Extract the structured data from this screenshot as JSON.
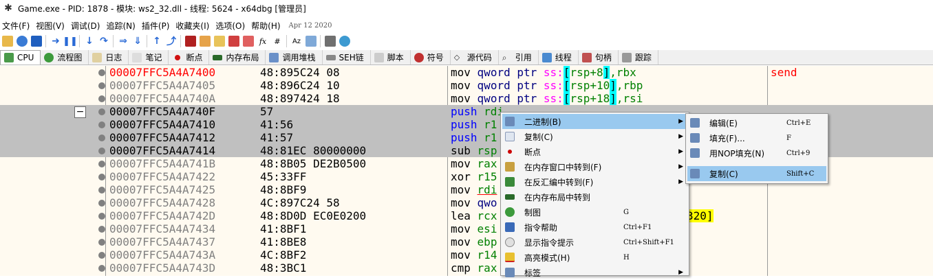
{
  "titlebar": {
    "title": "Game.exe - PID: 1878 - 模块: ws2_32.dll - 线程: 5624 - x64dbg [管理员]"
  },
  "menu": {
    "items": [
      "文件(F)",
      "视图(V)",
      "调试(D)",
      "追踪(N)",
      "插件(P)",
      "收藏夹(I)",
      "选项(O)",
      "帮助(H)"
    ],
    "date": "Apr 12 2020"
  },
  "tabs": [
    {
      "label": "CPU",
      "icon": "cpu-icon"
    },
    {
      "label": "流程图",
      "icon": "tree-icon"
    },
    {
      "label": "日志",
      "icon": "log-icon"
    },
    {
      "label": "笔记",
      "icon": "notes-icon"
    },
    {
      "label": "断点",
      "icon": "breakpoint-icon"
    },
    {
      "label": "内存布局",
      "icon": "memory-icon"
    },
    {
      "label": "调用堆栈",
      "icon": "callstack-icon"
    },
    {
      "label": "SEH链",
      "icon": "seh-icon"
    },
    {
      "label": "脚本",
      "icon": "script-icon"
    },
    {
      "label": "符号",
      "icon": "symbol-icon"
    },
    {
      "label": "源代码",
      "icon": "source-icon"
    },
    {
      "label": "引用",
      "icon": "search-icon"
    },
    {
      "label": "线程",
      "icon": "thread-icon"
    },
    {
      "label": "句柄",
      "icon": "handle-icon"
    },
    {
      "label": "跟踪",
      "icon": "trace-icon"
    }
  ],
  "disasm": {
    "rows": [
      {
        "addr": "00007FFC5A4A7400",
        "bytes": "48:895C24 08"
      },
      {
        "addr": "00007FFC5A4A7405",
        "bytes": "48:896C24 10"
      },
      {
        "addr": "00007FFC5A4A740A",
        "bytes": "48:897424 18"
      },
      {
        "addr": "00007FFC5A4A740F",
        "bytes": "57"
      },
      {
        "addr": "00007FFC5A4A7410",
        "bytes": "41:56"
      },
      {
        "addr": "00007FFC5A4A7412",
        "bytes": "41:57"
      },
      {
        "addr": "00007FFC5A4A7414",
        "bytes": "48:81EC 80000000"
      },
      {
        "addr": "00007FFC5A4A741B",
        "bytes": "48:8B05 DE2B0500"
      },
      {
        "addr": "00007FFC5A4A7422",
        "bytes": "45:33FF"
      },
      {
        "addr": "00007FFC5A4A7425",
        "bytes": "48:8BF9"
      },
      {
        "addr": "00007FFC5A4A7428",
        "bytes": "4C:897C24 58"
      },
      {
        "addr": "00007FFC5A4A742D",
        "bytes": "48:8D0D EC0E0200"
      },
      {
        "addr": "00007FFC5A4A7434",
        "bytes": "41:8BF1"
      },
      {
        "addr": "00007FFC5A4A7437",
        "bytes": "41:8BE8"
      },
      {
        "addr": "00007FFC5A4A743A",
        "bytes": "4C:8BF2"
      },
      {
        "addr": "00007FFC5A4A743D",
        "bytes": "48:3BC1"
      }
    ],
    "ins": {
      "mov": "mov",
      "push": "push",
      "sub": "sub",
      "xor": "xor",
      "lea": "lea",
      "cmp": "cmp",
      "qword": "qword ptr",
      "ss": "ss:",
      "l0b": "rsp+8",
      "l0r": ",rbx",
      "l1b": "rsp+10",
      "l1r": ",rbp",
      "l2b": "rsp+18",
      "l2r": ",rsi",
      "rdi": "rdi",
      "r1a": "r1",
      "r1b": "r1",
      "rsp": "rsp",
      "rax": "rax",
      "r15": "r15",
      "rdi2": "rdi",
      "qwo": "qwo",
      "rcx": "rcx",
      "tail320": "320]",
      "esi": "esi",
      "ebp": "ebp",
      "r14": "r14",
      "rax2": "rax"
    },
    "comment": "send",
    "fold": "−"
  },
  "context_menu": {
    "items": [
      {
        "label": "二进制(B)",
        "shortcut": "",
        "submenu": true,
        "icon": "binary-icon"
      },
      {
        "label": "复制(C)",
        "shortcut": "",
        "submenu": true,
        "icon": "copy-icon"
      },
      {
        "label": "断点",
        "shortcut": "",
        "submenu": true,
        "icon": "breakpoint-icon"
      },
      {
        "label": "在内存窗口中转到(F)",
        "shortcut": "",
        "submenu": true,
        "icon": "dump-icon"
      },
      {
        "label": "在反汇编中转到(F)",
        "shortcut": "",
        "submenu": true,
        "icon": "disasm-icon"
      },
      {
        "label": "在内存布局中转到",
        "shortcut": "",
        "submenu": false,
        "icon": "memmap-icon"
      },
      {
        "label": "制图",
        "shortcut": "G",
        "submenu": false,
        "icon": "graph-icon"
      },
      {
        "label": "指令帮助",
        "shortcut": "Ctrl+F1",
        "submenu": false,
        "icon": "help-icon"
      },
      {
        "label": "显示指令提示",
        "shortcut": "Ctrl+Shift+F1",
        "submenu": false,
        "icon": "hint-icon"
      },
      {
        "label": "高亮模式(H)",
        "shortcut": "H",
        "submenu": false,
        "icon": "highlight-icon"
      },
      {
        "label": "标签",
        "shortcut": "",
        "submenu": true,
        "icon": "label-icon"
      }
    ],
    "arrow": "▶"
  },
  "submenu": {
    "items": [
      {
        "label": "编辑(E)",
        "shortcut": "Ctrl+E"
      },
      {
        "label": "填充(F)...",
        "shortcut": "F"
      },
      {
        "label": "用NOP填充(N)",
        "shortcut": "Ctrl+9"
      },
      {
        "label": "复制(C)",
        "shortcut": "Shift+C"
      }
    ]
  },
  "colors": {
    "selection": "#c0c0c0",
    "menu_highlight": "#99c9ef",
    "address_red": "#ff0000",
    "background": "#fffaf0"
  }
}
